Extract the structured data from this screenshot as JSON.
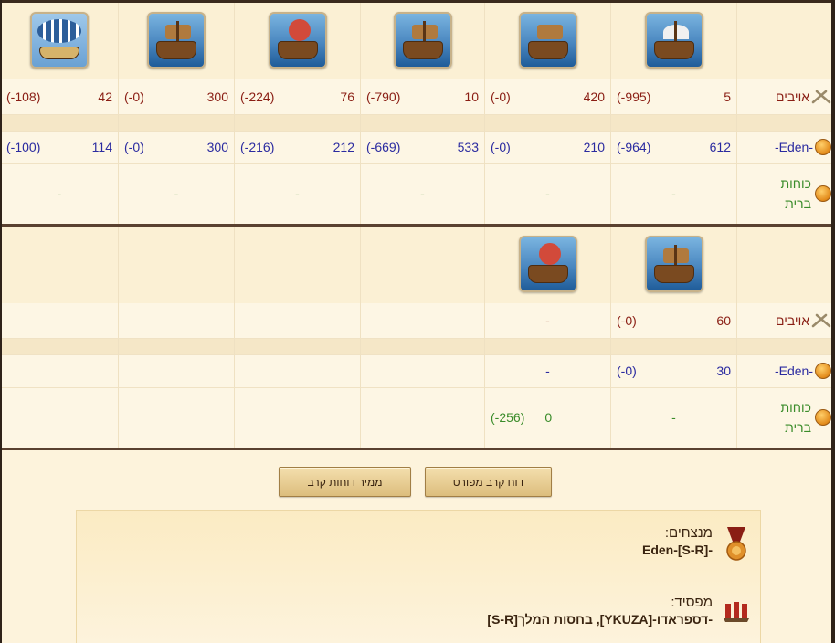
{
  "table1": {
    "enemy_label": "אויבים",
    "eden_label": "-Eden-",
    "ally_label": "כוחות ברית",
    "units": [
      {
        "icon": "siege-ship-icon",
        "enemy": "5",
        "enemy_loss": "(995-)",
        "eden": "612",
        "eden_loss": "(964-)",
        "ally": "-"
      },
      {
        "icon": "mortar-ship-icon",
        "enemy": "420",
        "enemy_loss": "(0-)",
        "eden": "210",
        "eden_loss": "(0-)",
        "ally": "-"
      },
      {
        "icon": "paddle-ship-icon",
        "enemy": "10",
        "enemy_loss": "(790-)",
        "eden": "533",
        "eden_loss": "(669-)",
        "ally": "-"
      },
      {
        "icon": "ram-ship-icon",
        "enemy": "76",
        "enemy_loss": "(224-)",
        "eden": "212",
        "eden_loss": "(216-)",
        "ally": "-"
      },
      {
        "icon": "catapult-ship-icon",
        "enemy": "300",
        "enemy_loss": "(0-)",
        "eden": "300",
        "eden_loss": "(0-)",
        "ally": "-"
      },
      {
        "icon": "balloon-carrier-icon",
        "enemy": "42",
        "enemy_loss": "(108-)",
        "eden": "114",
        "eden_loss": "(100-)",
        "ally": "-"
      }
    ]
  },
  "table2": {
    "enemy_label": "אויבים",
    "eden_label": "-Eden-",
    "ally_label": "כוחות ברית",
    "units": [
      {
        "icon": "ballista-ship-icon",
        "enemy": "60",
        "enemy_loss": "(0-)",
        "eden": "30",
        "eden_loss": "(0-)",
        "ally": "-",
        "ally_loss": ""
      },
      {
        "icon": "fire-ship-icon",
        "enemy": "-",
        "enemy_loss": "",
        "eden": "-",
        "eden_loss": "",
        "ally": "0",
        "ally_loss": "(256-)"
      }
    ]
  },
  "buttons": {
    "detailed": "דוח קרב מפורט",
    "summary": "ממיר דוחות קרב"
  },
  "report": {
    "winners_label": "מנצחים:",
    "winners_value": "-Eden-[S-R]",
    "loser_label": "מפסיד:",
    "loser_value": "-דספראדו-[YKUZA], בחסות המלך[S-R]"
  }
}
